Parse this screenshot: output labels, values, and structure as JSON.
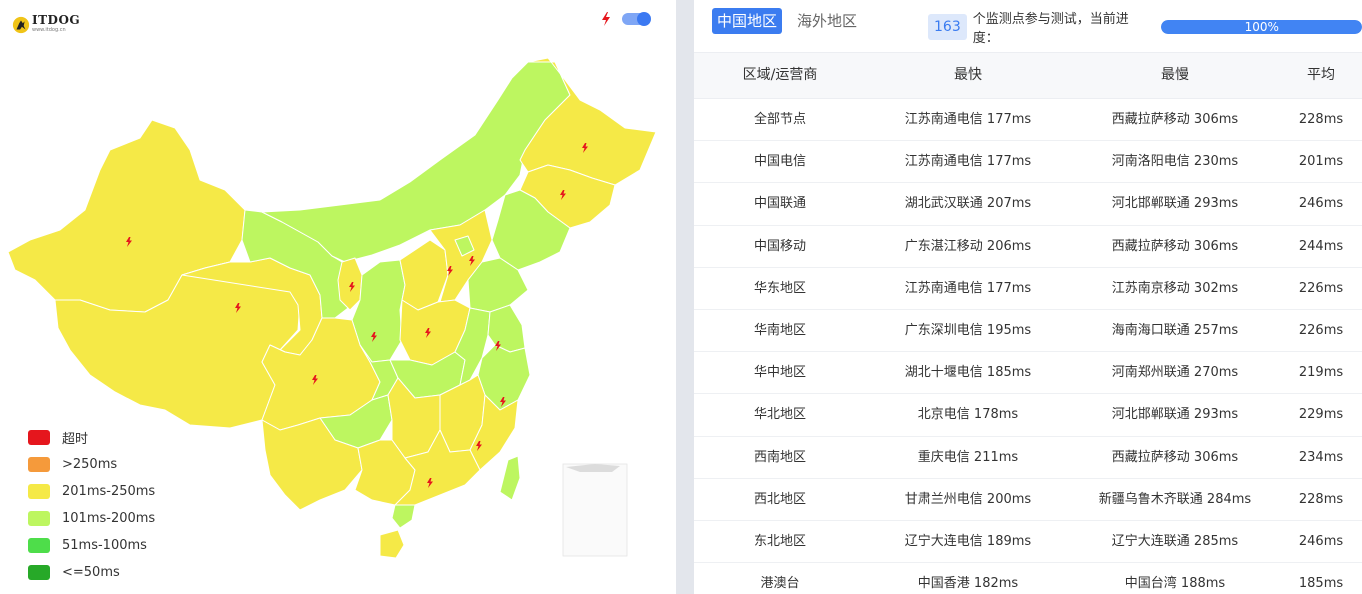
{
  "brand": {
    "name": "ITDOG",
    "url": "www.itdog.cn"
  },
  "colors": {
    "timeout": "#e5161d",
    "over250": "#f59a3b",
    "r201_250": "#f5e947",
    "r101_200": "#bdf660",
    "r51_100": "#4edd4a",
    "under50": "#27a928",
    "accent": "#3b7cf0"
  },
  "icons": {
    "probe": "lightning-bolt-icon",
    "toggle": "toggle-switch",
    "logo": "dog-logo-icon"
  },
  "legend": [
    {
      "label": "超时",
      "color": "#e5161d"
    },
    {
      "label": ">250ms",
      "color": "#f59a3b"
    },
    {
      "label": "201ms-250ms",
      "color": "#f5e947"
    },
    {
      "label": "101ms-200ms",
      "color": "#bdf660"
    },
    {
      "label": "51ms-100ms",
      "color": "#4edd4a"
    },
    {
      "label": "<=50ms",
      "color": "#27a928"
    }
  ],
  "tabs": {
    "active": "中国地区",
    "inactive": "海外地区"
  },
  "progress": {
    "count": "163",
    "text": "个监测点参与测试，当前进度：",
    "label": "100%",
    "value": 1.0
  },
  "table": {
    "headers": [
      "区域/运营商",
      "最快",
      "最慢",
      "平均"
    ],
    "rows": [
      [
        "全部节点",
        "江苏南通电信 177ms",
        "西藏拉萨移动 306ms",
        "228ms"
      ],
      [
        "中国电信",
        "江苏南通电信 177ms",
        "河南洛阳电信 230ms",
        "201ms"
      ],
      [
        "中国联通",
        "湖北武汉联通 207ms",
        "河北邯郸联通 293ms",
        "246ms"
      ],
      [
        "中国移动",
        "广东湛江移动 206ms",
        "西藏拉萨移动 306ms",
        "244ms"
      ],
      [
        "华东地区",
        "江苏南通电信 177ms",
        "江苏南京移动 302ms",
        "226ms"
      ],
      [
        "华南地区",
        "广东深圳电信 195ms",
        "海南海口联通 257ms",
        "226ms"
      ],
      [
        "华中地区",
        "湖北十堰电信 185ms",
        "河南郑州联通 270ms",
        "219ms"
      ],
      [
        "华北地区",
        "北京电信 178ms",
        "河北邯郸联通 293ms",
        "229ms"
      ],
      [
        "西南地区",
        "重庆电信 211ms",
        "西藏拉萨移动 306ms",
        "234ms"
      ],
      [
        "西北地区",
        "甘肃兰州电信 200ms",
        "新疆乌鲁木齐联通 284ms",
        "228ms"
      ],
      [
        "东北地区",
        "辽宁大连电信 189ms",
        "辽宁大连联通 285ms",
        "246ms"
      ],
      [
        "港澳台",
        "中国香港 182ms",
        "中国台湾 188ms",
        "185ms"
      ]
    ]
  }
}
